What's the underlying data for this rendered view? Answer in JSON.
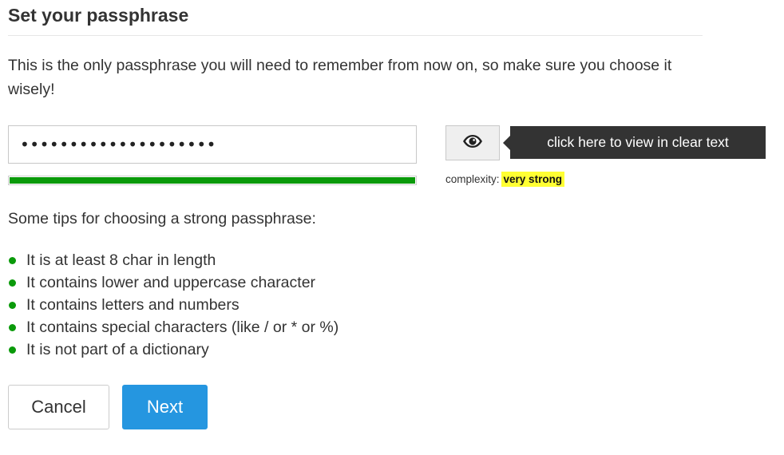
{
  "header": {
    "title": "Set your passphrase"
  },
  "intro": {
    "text": "This is the only passphrase you will need to remember from now on, so make sure you choose it wisely!"
  },
  "passphrase": {
    "masked_value": "••••••••••••••••••••",
    "strength_fill_fraction": 1.0,
    "strength_color": "#0a9a0a"
  },
  "view_button": {
    "icon": "eye-icon",
    "tooltip": "click here to view in clear text"
  },
  "complexity": {
    "label": "complexity:",
    "value": "very strong",
    "highlight_color": "#ffff33"
  },
  "tips": {
    "heading": "Some tips for choosing a strong passphrase:",
    "bullet_color": "#0a9a0a",
    "items": [
      "It is at least 8 char in length",
      "It contains lower and uppercase character",
      "It contains letters and numbers",
      "It contains special characters (like / or * or %)",
      "It is not part of a dictionary"
    ]
  },
  "actions": {
    "cancel_label": "Cancel",
    "next_label": "Next",
    "next_color": "#2596e0"
  }
}
